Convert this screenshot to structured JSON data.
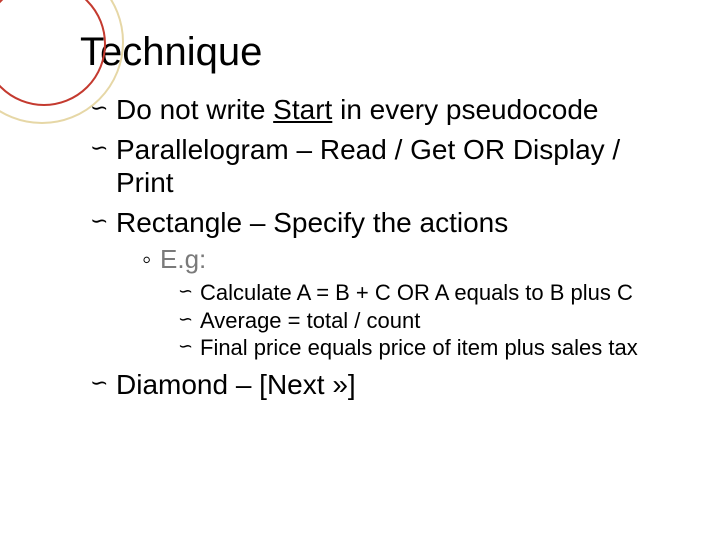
{
  "slide": {
    "title": "Technique",
    "bullets": [
      {
        "pre": "Do not write ",
        "underlined": "Start",
        "post": " in every pseudocode"
      },
      {
        "text": "Parallelogram – Read / Get OR Display / Print"
      },
      {
        "text": "Rectangle – Specify the actions",
        "sub": {
          "label": "E.g:",
          "items": [
            "Calculate A = B + C OR A equals to B plus C",
            "Average = total / count",
            "Final price equals price of item plus sales tax"
          ]
        }
      },
      {
        "text": "Diamond – [Next »]"
      }
    ]
  }
}
